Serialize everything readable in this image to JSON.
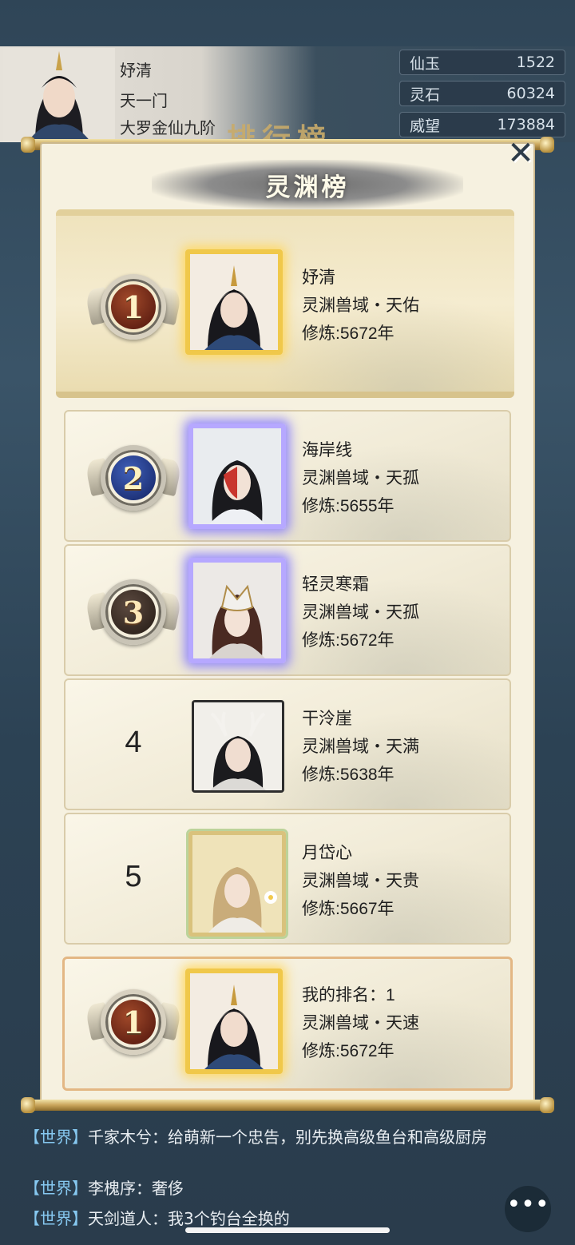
{
  "player": {
    "name": "妤清",
    "sect": "天一门",
    "realm": "大罗金仙九阶"
  },
  "resources": [
    {
      "label": "仙玉",
      "value": "1522"
    },
    {
      "label": "灵石",
      "value": "60324"
    },
    {
      "label": "威望",
      "value": "173884"
    }
  ],
  "background_title": "排行榜",
  "modal": {
    "title": "灵渊榜",
    "close_glyph": "✕"
  },
  "rankings": [
    {
      "rank": "1",
      "name": "妤清",
      "region": "灵渊兽域・天佑",
      "cultivation": "修炼:5672年",
      "medal": "gold",
      "frame": "gold",
      "avatar": "crowned-woman"
    },
    {
      "rank": "2",
      "name": "海岸线",
      "region": "灵渊兽域・天孤",
      "cultivation": "修炼:5655年",
      "medal": "silver",
      "frame": "violet",
      "avatar": "masked-man"
    },
    {
      "rank": "3",
      "name": "轻灵寒霜",
      "region": "灵渊兽域・天孤",
      "cultivation": "修炼:5672年",
      "medal": "bronze",
      "frame": "violet",
      "avatar": "fox-mask-woman"
    },
    {
      "rank": "4",
      "name": "干泠崖",
      "region": "灵渊兽域・天满",
      "cultivation": "修炼:5638年",
      "medal": "none",
      "frame": "plain",
      "avatar": "antler-man"
    },
    {
      "rank": "5",
      "name": "月岱心",
      "region": "灵渊兽域・天贵",
      "cultivation": "修炼:5667年",
      "medal": "none",
      "frame": "leaf",
      "avatar": "blonde-woman"
    }
  ],
  "my_rank": {
    "rank": "1",
    "label": "我的排名：1",
    "region": "灵渊兽域・天速",
    "cultivation": "修炼:5672年"
  },
  "chat": [
    {
      "channel": "【世界】",
      "text": "千家木兮：给萌新一个忠告，别先换高级鱼台和高级厨房"
    },
    {
      "channel": "【世界】",
      "text": "李槐序：奢侈"
    },
    {
      "channel": "【世界】",
      "text": "天剑道人：我3个钓台全换的"
    }
  ],
  "chat_icon": "chat-bubble-icon"
}
